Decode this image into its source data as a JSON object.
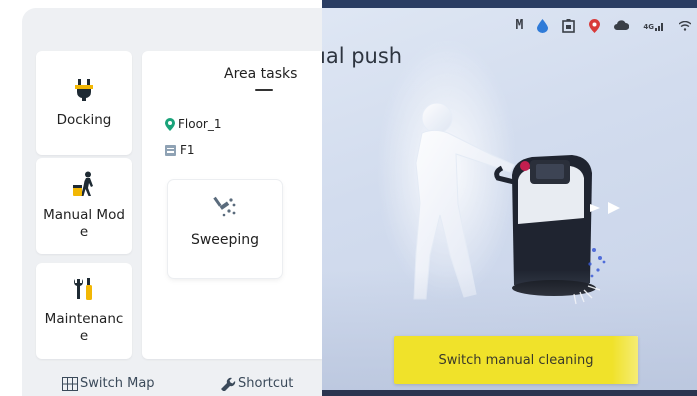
{
  "left_panel": {
    "side_buttons": [
      {
        "label": "Docking",
        "icon": "plug-icon"
      },
      {
        "label": "Manual Mod\ne",
        "icon": "person-push-icon"
      },
      {
        "label": "Maintenanc\ne",
        "icon": "tools-icon"
      }
    ],
    "area_tasks": {
      "title": "Area tasks",
      "floor_label": "Floor_1",
      "map_label": "F1",
      "task_card_label": "Sweeping"
    },
    "bottom_links": {
      "switch_map": "Switch Map",
      "shortcut": "Shortcut"
    }
  },
  "right_panel": {
    "title_fragment": "ıal push",
    "status_bar": {
      "m_label": "M",
      "signal_label": "4G"
    },
    "action_button": "Switch manual cleaning"
  },
  "colors": {
    "accent_yellow": "#f0e22a",
    "location_green": "#1aa37a",
    "panel_bg": "#eef0f3"
  }
}
